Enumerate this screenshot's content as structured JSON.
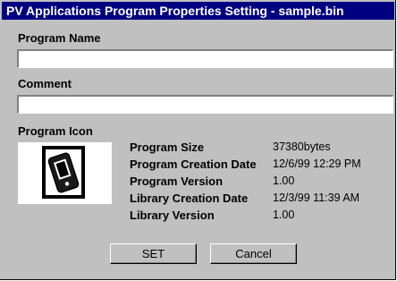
{
  "window": {
    "title": "PV Applications Program Properties Setting - sample.bin"
  },
  "program_name": {
    "label": "Program Name",
    "value": ""
  },
  "comment": {
    "label": "Comment",
    "value": ""
  },
  "program_icon": {
    "label": "Program Icon",
    "icon": "handheld-device-icon"
  },
  "properties": [
    {
      "label": "Program Size",
      "value": "37380bytes"
    },
    {
      "label": "Program Creation Date",
      "value": "12/6/99 12:29 PM"
    },
    {
      "label": "Program Version",
      "value": "1.00"
    },
    {
      "label": "Library Creation Date",
      "value": "12/3/99 11:39 AM"
    },
    {
      "label": "Library Version",
      "value": "1.00"
    }
  ],
  "buttons": {
    "set_label": "SET",
    "cancel_label": "Cancel"
  },
  "colors": {
    "title_bar": "#000080",
    "dialog_face": "#c0c0c0"
  }
}
